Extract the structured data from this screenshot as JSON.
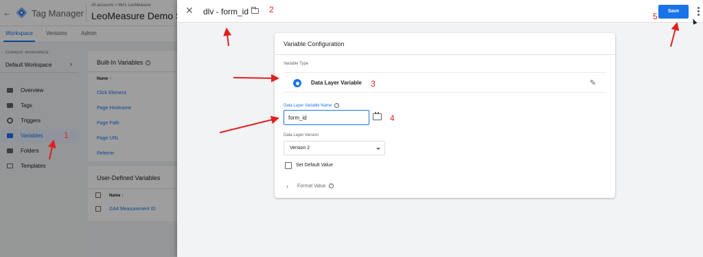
{
  "gtm": {
    "product_name": "Tag Manager",
    "breadcrumb": "All accounts > Md's LeoMeasure",
    "container_name": "LeoMeasure Demo Site",
    "nav_tabs": [
      "Workspace",
      "Versions",
      "Admin"
    ],
    "current_workspace_label": "CURRENT WORKSPACE",
    "workspace_name": "Default Workspace",
    "sidebar_items": [
      {
        "label": "Overview",
        "icon": "overview-icon"
      },
      {
        "label": "Tags",
        "icon": "tag-icon"
      },
      {
        "label": "Triggers",
        "icon": "trigger-icon"
      },
      {
        "label": "Variables",
        "icon": "variables-icon",
        "active": true
      },
      {
        "label": "Folders",
        "icon": "folder-icon"
      },
      {
        "label": "Templates",
        "icon": "template-icon"
      }
    ],
    "builtin": {
      "title": "Built-In Variables",
      "col_name": "Name ↑",
      "items": [
        "Click Element",
        "Page Hostname",
        "Page Path",
        "Page URL",
        "Referrer"
      ]
    },
    "userdefined": {
      "title": "User-Defined Variables",
      "col_name": "Name ↑",
      "items": [
        "GA4 Measurement ID"
      ]
    }
  },
  "panel": {
    "title": "dlv - form_id",
    "save_label": "Save",
    "config_title": "Variable Configuration",
    "variable_type_label": "Variable Type",
    "variable_type_name": "Data Layer Variable",
    "dlv_name_label": "Data Layer Variable Name",
    "dlv_name_value": "form_id",
    "dlv_version_label": "Data Layer Version",
    "dlv_version_value": "Version 2",
    "set_default_label": "Set Default Value",
    "format_value_label": "Format Value"
  },
  "annotations": {
    "numbers": [
      "1",
      "2",
      "3",
      "4",
      "5"
    ],
    "color": "#e02020"
  },
  "colors": {
    "accent": "#1a73e8",
    "annotation": "#e02020"
  }
}
